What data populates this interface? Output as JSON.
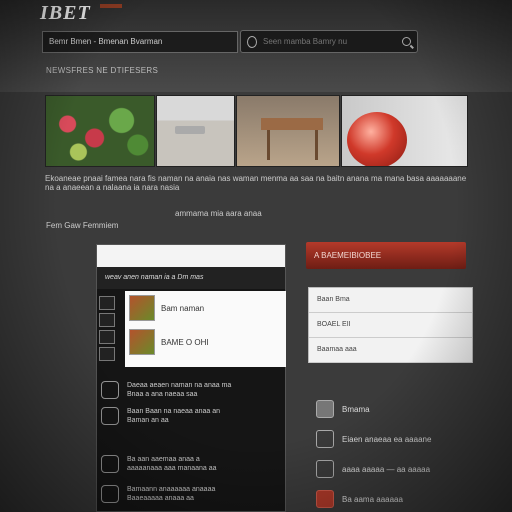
{
  "header": {
    "logo": "IBET"
  },
  "nav": {
    "label": "Bemr Bmen - Bmenan Bvarman"
  },
  "search": {
    "placeholder": "Seen mamba Bamry nu"
  },
  "breadcrumb": "NEWSFRES NE DTIFESERS",
  "intro": {
    "text": "Ekoaneae pnaai famea nara fis naman na anaia nas waman menma aa saa na baitn anana ma mana basa aaaaaaane na a anaeean a nalaana ia nara nasia"
  },
  "subtitle": "ammama mia aara anaa",
  "section_label": "Fem Gaw  Femmiem",
  "panel": {
    "title": "weav anen naman ia a Dm mas",
    "items": [
      {
        "label": "Bam naman"
      },
      {
        "label": "BAME O OHI"
      }
    ],
    "features": [
      {
        "title": "Daeaa aeaen naman na anaa ma",
        "text": "Bnaa a ana naeaa saa"
      },
      {
        "title": "Baan Baan na naeaa anaa an",
        "text": "Baman an aa"
      },
      {
        "title": "Ba aan aaemaa anaa a",
        "text": "aaaaanaaa aaa manaana aa"
      },
      {
        "title": "Bamaann anaaaaaa anaaaa",
        "text": "Baaeaaaaa anaaa aa"
      }
    ]
  },
  "cta": "A BAEMEIBIOBEE",
  "login": {
    "rows": [
      "Baan Bma",
      "BOAEL EII",
      "Baamaa aaa"
    ]
  },
  "links": [
    {
      "label": "Bmama"
    },
    {
      "label": "Eiaen anaeaa ea aaaane"
    },
    {
      "label": "aaaa aaaaa — aa aaaaa"
    },
    {
      "label": "Ba aama       aaaaaa"
    }
  ]
}
